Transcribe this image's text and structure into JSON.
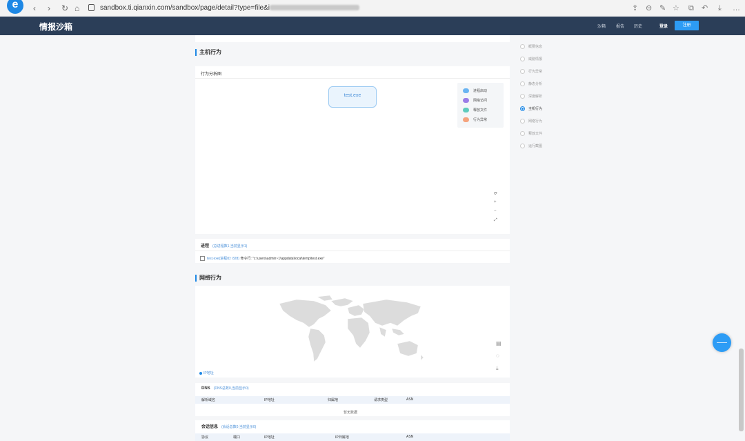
{
  "browser": {
    "url": "sandbox.ti.qianxin.com/sandbox/page/detail?type=file&i"
  },
  "header": {
    "logo": "情报沙箱",
    "nav": [
      "沙箱",
      "报告",
      "历史"
    ],
    "login": "登录",
    "register": "注册"
  },
  "host_behavior": {
    "title": "主机行为",
    "graph_title": "行为分析图",
    "node": "test.exe",
    "legend": [
      {
        "label": "进程启动",
        "color": "#6ab4f2"
      },
      {
        "label": "网络访问",
        "color": "#9b7de8"
      },
      {
        "label": "释放文件",
        "color": "#5ecbbd"
      },
      {
        "label": "行为异常",
        "color": "#f5a37d"
      }
    ],
    "zoom_controls": [
      "⟳",
      "+",
      "−",
      "⤢"
    ]
  },
  "process": {
    "title": "进程",
    "subtitle": "(总进程数1,当前显示1)",
    "entry_link": "test.exe(进程ID: 828)",
    "entry_cmd": "命令行: \"c:\\users\\admin~1\\appdata\\local\\temp\\test.exe\""
  },
  "network_behavior": {
    "title": "网络行为",
    "map_legend": "IP地址"
  },
  "dns": {
    "title": "DNS",
    "subtitle": "(DNS总数0,当前显示0)",
    "columns": [
      "解析域名",
      "IP地址",
      "归属地",
      "请求类型",
      "ASN"
    ],
    "empty_text": "暂无数据"
  },
  "session": {
    "title": "会话信息",
    "subtitle": "(会话总数0,当前显示0)",
    "columns": [
      "协议",
      "端口",
      "IP地址",
      "IP归属地",
      "ASN"
    ]
  },
  "right_nav": {
    "items": [
      "概要信息",
      "威胁情报",
      "行为异常",
      "静态分析",
      "深度解析",
      "主机行为",
      "网络行为",
      "释放文件",
      "运行截图"
    ],
    "active": "主机行为"
  }
}
